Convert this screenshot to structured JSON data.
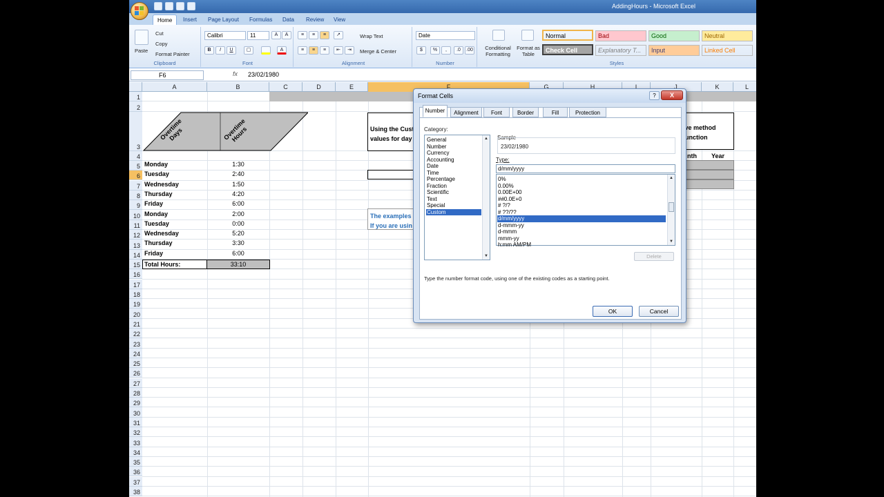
{
  "window": {
    "title": "AddingHours - Microsoft Excel"
  },
  "ribbon": {
    "tabs": [
      "Home",
      "Insert",
      "Page Layout",
      "Formulas",
      "Data",
      "Review",
      "View"
    ],
    "clipboard": {
      "label": "Clipboard",
      "paste": "Paste",
      "cut": "Cut",
      "copy": "Copy",
      "format_painter": "Format Painter"
    },
    "font": {
      "label": "Font",
      "name": "Calibri",
      "size": "11",
      "bold": "B",
      "italic": "I",
      "underline": "U"
    },
    "alignment": {
      "label": "Alignment",
      "wrap_text": "Wrap Text",
      "merge_center": "Merge & Center"
    },
    "number": {
      "label": "Number",
      "format": "Date",
      "currency": "$",
      "percent": "%",
      "comma": ","
    },
    "styles": {
      "label": "Styles",
      "conditional_formatting": "Conditional Formatting",
      "format_as_table": "Format as Table",
      "cells": [
        {
          "name": "Normal",
          "bg": "#ffffff",
          "fg": "#000000"
        },
        {
          "name": "Bad",
          "bg": "#ffc7ce",
          "fg": "#9c0006"
        },
        {
          "name": "Good",
          "bg": "#c6efce",
          "fg": "#006100"
        },
        {
          "name": "Neutral",
          "bg": "#ffeb9c",
          "fg": "#9c6500"
        },
        {
          "name": "Check Cell",
          "bg": "#a5a5a5",
          "fg": "#ffffff"
        },
        {
          "name": "Explanatory T...",
          "bg": "#ffffff",
          "fg": "#7f7f7f"
        },
        {
          "name": "Input",
          "bg": "#ffcc99",
          "fg": "#3f3f76"
        },
        {
          "name": "Linked Cell",
          "bg": "#ffffff",
          "fg": "#fa7d00"
        }
      ]
    }
  },
  "formula_bar": {
    "name_box": "F6",
    "fx": "fx",
    "value": "23/02/1980"
  },
  "sheet": {
    "columns": [
      "A",
      "B",
      "C",
      "D",
      "E",
      "F",
      "G",
      "H",
      "I",
      "J",
      "K",
      "L"
    ],
    "rows": [
      "1",
      "2",
      "3",
      "4",
      "5",
      "6",
      "7",
      "8",
      "9",
      "10",
      "11",
      "12",
      "13",
      "14",
      "15",
      "16",
      "17",
      "18",
      "19",
      "20",
      "21",
      "22",
      "23",
      "24",
      "25",
      "26",
      "27",
      "28",
      "29",
      "30",
      "31",
      "32",
      "33",
      "34",
      "35",
      "36",
      "37",
      "38"
    ],
    "header_days": "Overtime Days",
    "header_hours": "Overtime Hours",
    "data_rows": [
      {
        "day": "Monday",
        "hours": "1:30"
      },
      {
        "day": "Tuesday",
        "hours": "2:40"
      },
      {
        "day": "Wednesday",
        "hours": "1:50"
      },
      {
        "day": "Thursday",
        "hours": "4:20"
      },
      {
        "day": "Friday",
        "hours": "6:00"
      },
      {
        "day": "Monday",
        "hours": "2:00"
      },
      {
        "day": "Tuesday",
        "hours": "0:00"
      },
      {
        "day": "Wednesday",
        "hours": "5:20"
      },
      {
        "day": "Thursday",
        "hours": "3:30"
      },
      {
        "day": "Friday",
        "hours": "6:00"
      }
    ],
    "total_label": "Total Hours:",
    "total_value": "33:10",
    "textbox1_line1": "Using the Cust",
    "textbox1_line2": "values for day",
    "textbox2_line1": "The examples",
    "textbox2_line2": "If you are usin",
    "right_text_line1": "ive method",
    "right_text_line2": "function",
    "right_head_nth": "nth",
    "right_head_year": "Year"
  },
  "dialog": {
    "title": "Format Cells",
    "help": "?",
    "close": "X",
    "tabs": [
      "Number",
      "Alignment",
      "Font",
      "Border",
      "Fill",
      "Protection"
    ],
    "category_label": "Category:",
    "categories": [
      "General",
      "Number",
      "Currency",
      "Accounting",
      "Date",
      "Time",
      "Percentage",
      "Fraction",
      "Scientific",
      "Text",
      "Special",
      "Custom"
    ],
    "selected_category": "Custom",
    "sample_label": "Sample",
    "sample_value": "23/02/1980",
    "type_label": "Type:",
    "type_value": "d/mm/yyyy",
    "types": [
      "0%",
      "0.00%",
      "0.00E+00",
      "##0.0E+0",
      "# ?/?",
      "# ??/??",
      "d/mm/yyyy",
      "d-mmm-yy",
      "d-mmm",
      "mmm-yy",
      "h:mm AM/PM"
    ],
    "selected_type": "d/mm/yyyy",
    "delete": "Delete",
    "hint": "Type the number format code, using one of the existing codes as a starting point.",
    "ok": "OK",
    "cancel": "Cancel"
  }
}
